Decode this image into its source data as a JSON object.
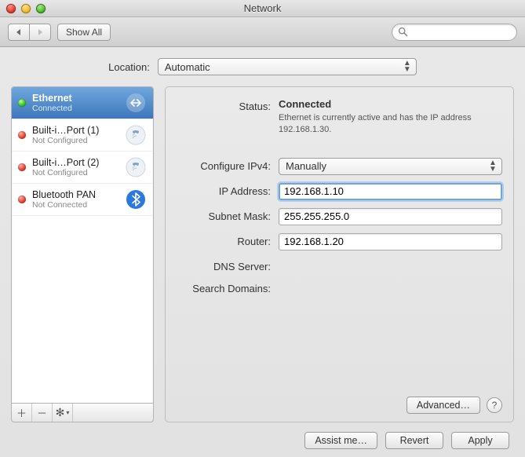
{
  "window": {
    "title": "Network"
  },
  "toolbar": {
    "show_all": "Show All",
    "search_placeholder": ""
  },
  "location": {
    "label": "Location:",
    "value": "Automatic"
  },
  "sidebar": {
    "items": [
      {
        "name": "Ethernet",
        "status": "Connected",
        "dot": "conn"
      },
      {
        "name": "Built-i…Port (1)",
        "status": "Not Configured",
        "dot": "off"
      },
      {
        "name": "Built-i…Port (2)",
        "status": "Not Configured",
        "dot": "off"
      },
      {
        "name": "Bluetooth PAN",
        "status": "Not Connected",
        "dot": "off"
      }
    ]
  },
  "detail": {
    "status_label": "Status:",
    "status_value": "Connected",
    "status_desc": "Ethernet is currently active and has the IP address 192.168.1.30.",
    "configure_label": "Configure IPv4:",
    "configure_value": "Manually",
    "ip_label": "IP Address:",
    "ip_value": "192.168.1.10",
    "mask_label": "Subnet Mask:",
    "mask_value": "255.255.255.0",
    "router_label": "Router:",
    "router_value": "192.168.1.20",
    "dns_label": "DNS Server:",
    "dns_value": "",
    "search_label": "Search Domains:",
    "search_value": "",
    "advanced": "Advanced…",
    "help": "?"
  },
  "buttons": {
    "assist": "Assist me…",
    "revert": "Revert",
    "apply": "Apply"
  }
}
